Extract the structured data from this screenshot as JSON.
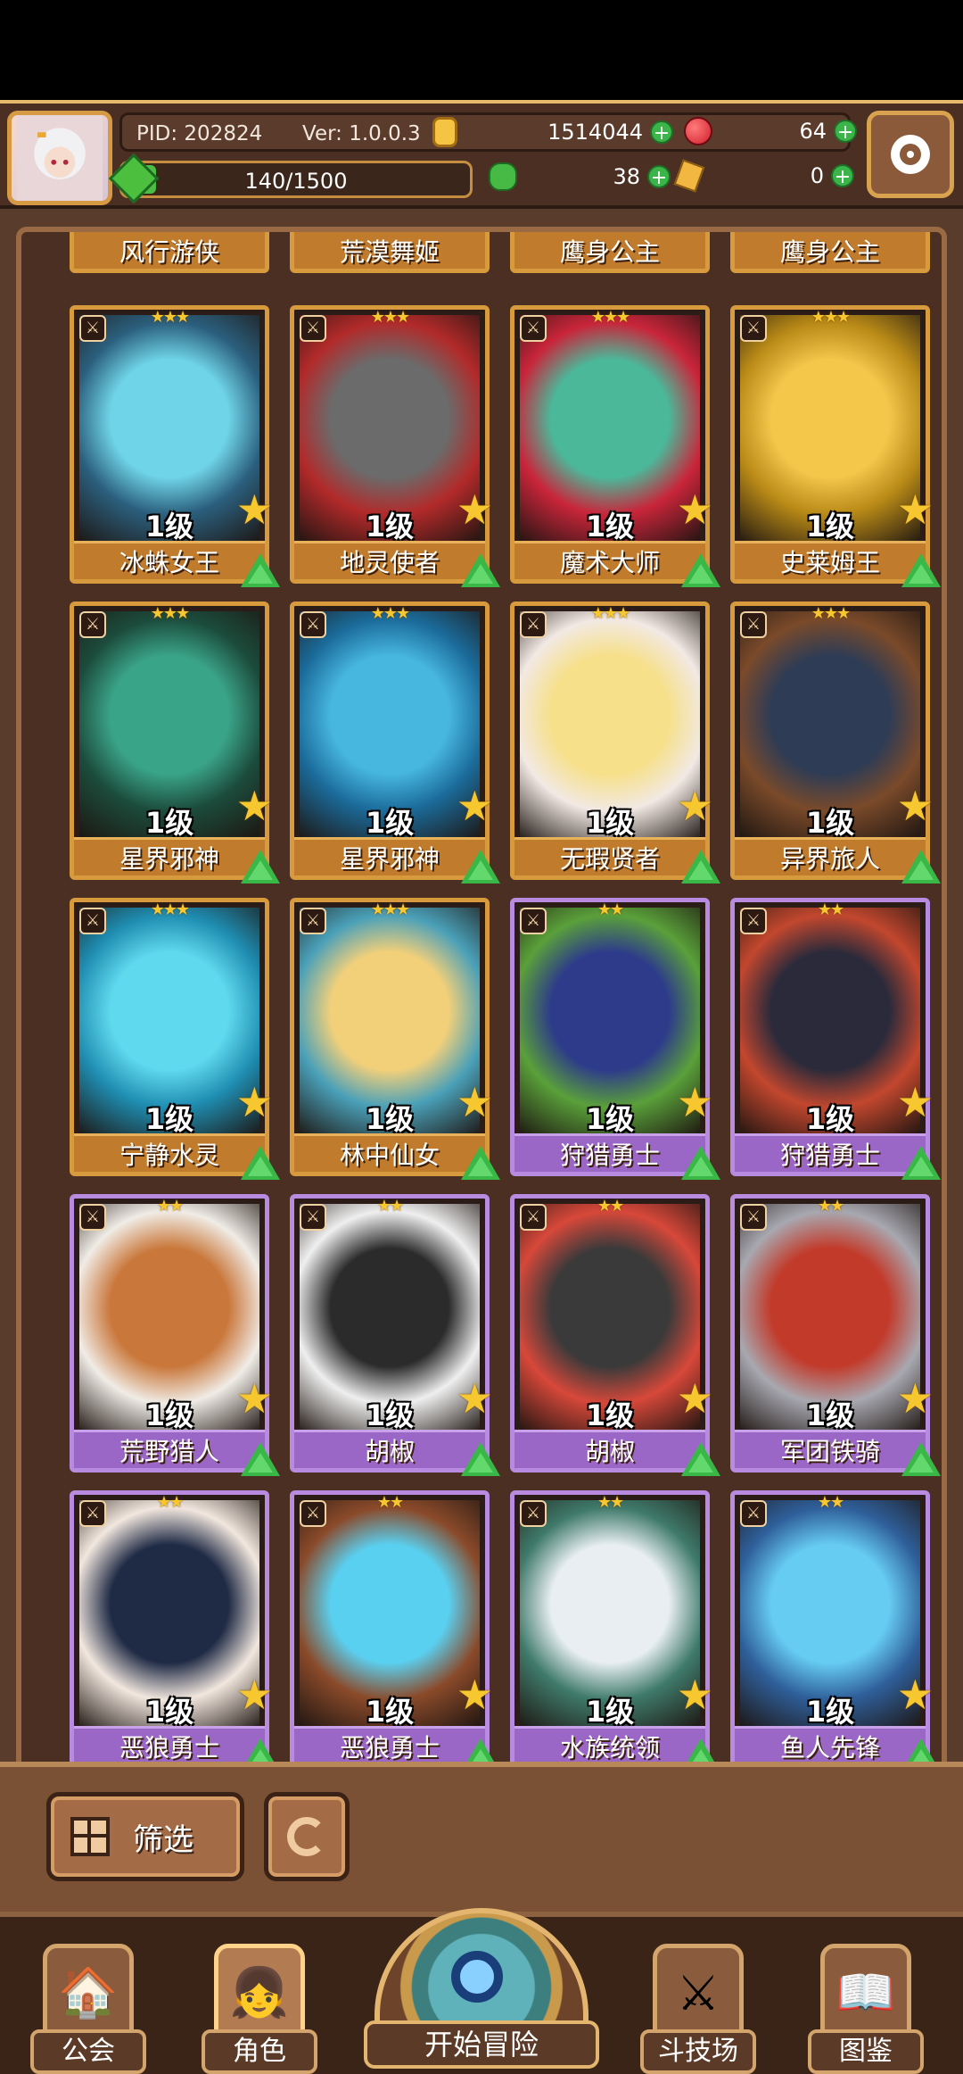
{
  "header": {
    "pid": "PID: 202824",
    "version": "Ver: 1.0.0.3",
    "gold": "1514044",
    "ruby": "64",
    "stamina_text": "140/1500",
    "stamina_fraction": 0.0933,
    "clover": "38",
    "keys": "0"
  },
  "top_row_cut": [
    {
      "name": "风行游侠"
    },
    {
      "name": "荒漠舞姬"
    },
    {
      "name": "鹰身公主"
    },
    {
      "name": "鹰身公主"
    }
  ],
  "cards": [
    {
      "name": "冰蛛女王",
      "level": "1级",
      "stars": "★★★",
      "rarity": "gold",
      "colors": [
        "#6fd4e8",
        "#2b5f7d"
      ]
    },
    {
      "name": "地灵使者",
      "level": "1级",
      "stars": "★★★",
      "rarity": "gold",
      "colors": [
        "#6b6b6b",
        "#b22a2a"
      ]
    },
    {
      "name": "魔术大师",
      "level": "1级",
      "stars": "★★★",
      "rarity": "gold",
      "colors": [
        "#4bb89a",
        "#c9253a"
      ]
    },
    {
      "name": "史莱姆王",
      "level": "1级",
      "stars": "★★★",
      "rarity": "gold",
      "colors": [
        "#f4c64a",
        "#b98a17"
      ]
    },
    {
      "name": "星界邪神",
      "level": "1级",
      "stars": "★★★",
      "rarity": "gold",
      "colors": [
        "#3aa488",
        "#1c4c3c"
      ]
    },
    {
      "name": "星界邪神",
      "level": "1级",
      "stars": "★★★",
      "rarity": "gold",
      "colors": [
        "#47b7e0",
        "#1b6b9a"
      ]
    },
    {
      "name": "无瑕贤者",
      "level": "1级",
      "stars": "★★★",
      "rarity": "gold",
      "colors": [
        "#f6e08a",
        "#f2e9e4"
      ]
    },
    {
      "name": "异界旅人",
      "level": "1级",
      "stars": "★★★",
      "rarity": "gold",
      "colors": [
        "#2e3c55",
        "#7a4a2a"
      ]
    },
    {
      "name": "宁静水灵",
      "level": "1级",
      "stars": "★★★",
      "rarity": "gold",
      "colors": [
        "#5fd9ee",
        "#1f8db1"
      ]
    },
    {
      "name": "林中仙女",
      "level": "1级",
      "stars": "★★★",
      "rarity": "gold",
      "colors": [
        "#f2d07a",
        "#4aa0b8"
      ]
    },
    {
      "name": "狩猎勇士",
      "level": "1级",
      "stars": "★★",
      "rarity": "purple",
      "colors": [
        "#2d3b8a",
        "#5aa03a"
      ]
    },
    {
      "name": "狩猎勇士",
      "level": "1级",
      "stars": "★★",
      "rarity": "purple",
      "colors": [
        "#2a2a3a",
        "#c2472e"
      ]
    },
    {
      "name": "荒野猎人",
      "level": "1级",
      "stars": "★★",
      "rarity": "purple",
      "colors": [
        "#c9773a",
        "#f0ece6"
      ]
    },
    {
      "name": "胡椒",
      "level": "1级",
      "stars": "★★",
      "rarity": "purple",
      "colors": [
        "#2b2b2b",
        "#efefef"
      ]
    },
    {
      "name": "胡椒",
      "level": "1级",
      "stars": "★★",
      "rarity": "purple",
      "colors": [
        "#3a3a3a",
        "#d7483a"
      ]
    },
    {
      "name": "军团铁骑",
      "level": "1级",
      "stars": "★★",
      "rarity": "purple",
      "colors": [
        "#c23a2a",
        "#a8a8b0"
      ]
    },
    {
      "name": "恶狼勇士",
      "level": "1级",
      "stars": "★★",
      "rarity": "purple",
      "colors": [
        "#1f2a45",
        "#f2e7de"
      ]
    },
    {
      "name": "恶狼勇士",
      "level": "1级",
      "stars": "★★",
      "rarity": "purple",
      "colors": [
        "#5ad0f0",
        "#8a4a2a"
      ]
    },
    {
      "name": "水族统领",
      "level": "1级",
      "stars": "★★",
      "rarity": "purple",
      "colors": [
        "#e8eef2",
        "#3f7a6a"
      ]
    },
    {
      "name": "鱼人先锋",
      "level": "1级",
      "stars": "★★",
      "rarity": "purple",
      "colors": [
        "#66ccf2",
        "#2f5f9a"
      ]
    }
  ],
  "controls": {
    "filter_label": "筛选"
  },
  "nav": [
    {
      "label": "公会",
      "icon": "guild-icon"
    },
    {
      "label": "角色",
      "icon": "character-icon"
    },
    {
      "label": "开始冒险",
      "icon": "adventure-magnifier-icon"
    },
    {
      "label": "斗技场",
      "icon": "arena-swords-icon"
    },
    {
      "label": "图鉴",
      "icon": "codex-book-icon"
    }
  ]
}
